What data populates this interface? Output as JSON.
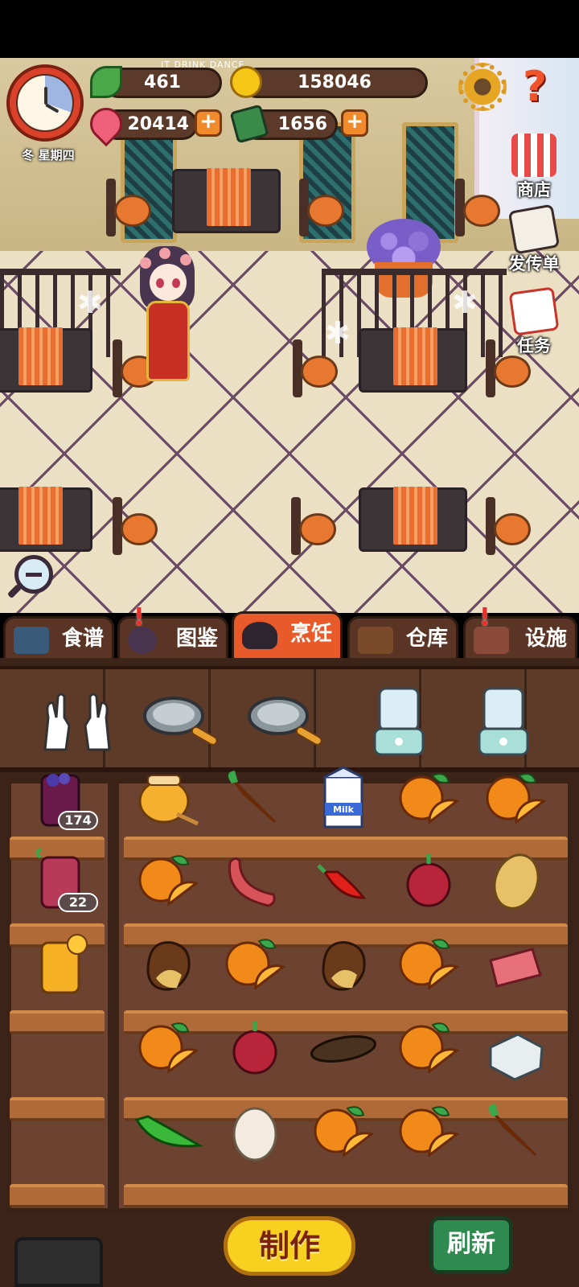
{
  "hud": {
    "clock_label": "冬 星期四",
    "leaf_value": "461",
    "coin_value": "158046",
    "heart_value": "20414",
    "book_value": "1656",
    "plus": "+",
    "help": "?"
  },
  "wall_sign": "IT DRINK DANCE",
  "side_buttons": [
    {
      "label": "商店",
      "icon": "shop-icon"
    },
    {
      "label": "发传单",
      "icon": "flyer-icon"
    },
    {
      "label": "任务",
      "icon": "task-icon"
    }
  ],
  "tabs": [
    {
      "label": "食谱",
      "icon": "recipe-book-icon",
      "active": false,
      "alert": false
    },
    {
      "label": "图鉴",
      "icon": "catalog-icon",
      "active": false,
      "alert": true
    },
    {
      "label": "烹饪",
      "icon": "cooking-pot-icon",
      "active": true,
      "alert": false
    },
    {
      "label": "仓库",
      "icon": "storage-icon",
      "active": false,
      "alert": false
    },
    {
      "label": "设施",
      "icon": "facility-icon",
      "active": false,
      "alert": true
    }
  ],
  "alert_mark": "!",
  "utensils": [
    "gloves-icon",
    "frying-pan-icon",
    "frying-pan-icon",
    "blender-icon",
    "blender-icon"
  ],
  "drinks": [
    {
      "icon": "grape-juice-icon",
      "count": "174"
    },
    {
      "icon": "berry-juice-icon",
      "count": "22"
    },
    {
      "icon": "orange-juice-icon",
      "count": ""
    }
  ],
  "ingredients": [
    [
      "honey-icon",
      "carrot-icon",
      "milk-icon",
      "orange-icon",
      "orange-icon"
    ],
    [
      "orange-icon",
      "sausage-icon",
      "chili-icon",
      "onion-icon",
      "potato-icon"
    ],
    [
      "chestnut-icon",
      "orange-icon",
      "chestnut-icon",
      "orange-icon",
      "meat-icon"
    ],
    [
      "orange-icon",
      "onion-icon",
      "sea-cucumber-icon",
      "orange-icon",
      "tofu-icon"
    ],
    [
      "green-pepper-icon",
      "egg-icon",
      "orange-icon",
      "orange-icon",
      "carrot-icon"
    ]
  ],
  "milk_text": "Milk",
  "buttons": {
    "make": "制作",
    "refresh": "刷新"
  }
}
